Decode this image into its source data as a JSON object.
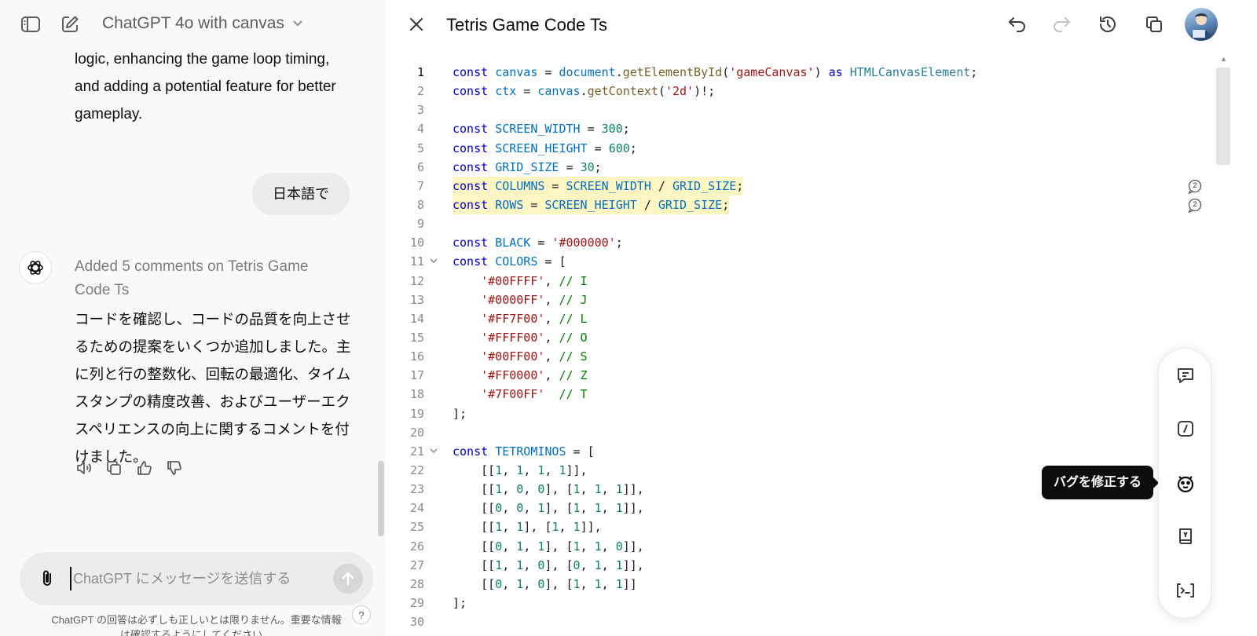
{
  "chat": {
    "model_title": "ChatGPT 4o with canvas",
    "prev_message_tail": "logic, enhancing the game loop timing, and adding a potential feature for better gameplay.",
    "user_message": "日本語で",
    "assistant_status": "Added 5 comments on Tetris Game Code Ts",
    "assistant_message": "コードを確認し、コードの品質を向上させるための提案をいくつか追加しました。主に列と行の整数化、回転の最適化、タイムスタンプの精度改善、およびユーザーエクスペリエンスの向上に関するコメントを付けました。",
    "composer_placeholder": "ChatGPT にメッセージを送信する",
    "disclaimer": "ChatGPT の回答は必ずしも正しいとは限りません。重要な情報は確認するようにしてください。",
    "help_label": "?"
  },
  "canvas": {
    "title": "Tetris Game Code Ts",
    "comment_counts": [
      "2",
      "2"
    ],
    "tooltip": "バグを修正する",
    "code_lines": [
      {
        "n": "1",
        "text": "const canvas = document.getElementById('gameCanvas') as HTMLCanvasElement;"
      },
      {
        "n": "2",
        "text": "const ctx = canvas.getContext('2d')!;"
      },
      {
        "n": "3",
        "text": ""
      },
      {
        "n": "4",
        "text": "const SCREEN_WIDTH = 300;"
      },
      {
        "n": "5",
        "text": "const SCREEN_HEIGHT = 600;"
      },
      {
        "n": "6",
        "text": "const GRID_SIZE = 30;"
      },
      {
        "n": "7",
        "text": "const COLUMNS = SCREEN_WIDTH / GRID_SIZE;"
      },
      {
        "n": "8",
        "text": "const ROWS = SCREEN_HEIGHT / GRID_SIZE;"
      },
      {
        "n": "9",
        "text": ""
      },
      {
        "n": "10",
        "text": "const BLACK = '#000000';"
      },
      {
        "n": "11",
        "text": "const COLORS = ["
      },
      {
        "n": "12",
        "text": "    '#00FFFF', // I"
      },
      {
        "n": "13",
        "text": "    '#0000FF', // J"
      },
      {
        "n": "14",
        "text": "    '#FF7F00', // L"
      },
      {
        "n": "15",
        "text": "    '#FFFF00', // O"
      },
      {
        "n": "16",
        "text": "    '#00FF00', // S"
      },
      {
        "n": "17",
        "text": "    '#FF0000', // Z"
      },
      {
        "n": "18",
        "text": "    '#7F00FF'  // T"
      },
      {
        "n": "19",
        "text": "];"
      },
      {
        "n": "20",
        "text": ""
      },
      {
        "n": "21",
        "text": "const TETROMINOS = ["
      },
      {
        "n": "22",
        "text": "    [[1, 1, 1, 1]],"
      },
      {
        "n": "23",
        "text": "    [[1, 0, 0], [1, 1, 1]],"
      },
      {
        "n": "24",
        "text": "    [[0, 0, 1], [1, 1, 1]],"
      },
      {
        "n": "25",
        "text": "    [[1, 1], [1, 1]],"
      },
      {
        "n": "26",
        "text": "    [[0, 1, 1], [1, 1, 0]],"
      },
      {
        "n": "27",
        "text": "    [[1, 1, 0], [0, 1, 1]],"
      },
      {
        "n": "28",
        "text": "    [[0, 1, 0], [1, 1, 1]]"
      },
      {
        "n": "29",
        "text": "];"
      },
      {
        "n": "30",
        "text": ""
      }
    ],
    "highlighted_lines": [
      "7",
      "8"
    ],
    "foldable_lines": [
      "11",
      "21"
    ],
    "active_line": "1"
  },
  "colors": {
    "keyword": "#0000cc",
    "identifier": "#0070c1",
    "string": "#a31515",
    "number": "#098658",
    "comment": "#008000",
    "highlight": "#fdf6c3",
    "tooltip_bg": "#0d0d0d"
  },
  "icons": {
    "sidebar_toggle": "sidebar-toggle-icon",
    "new_chat": "new-chat-icon",
    "undo": "undo-icon",
    "redo": "redo-icon",
    "history": "version-history-icon",
    "copy": "copy-icon",
    "tools": [
      "comment-icon",
      "edit-length-icon",
      "bug-fix-icon",
      "reading-level-icon",
      "code-terminal-icon"
    ]
  }
}
